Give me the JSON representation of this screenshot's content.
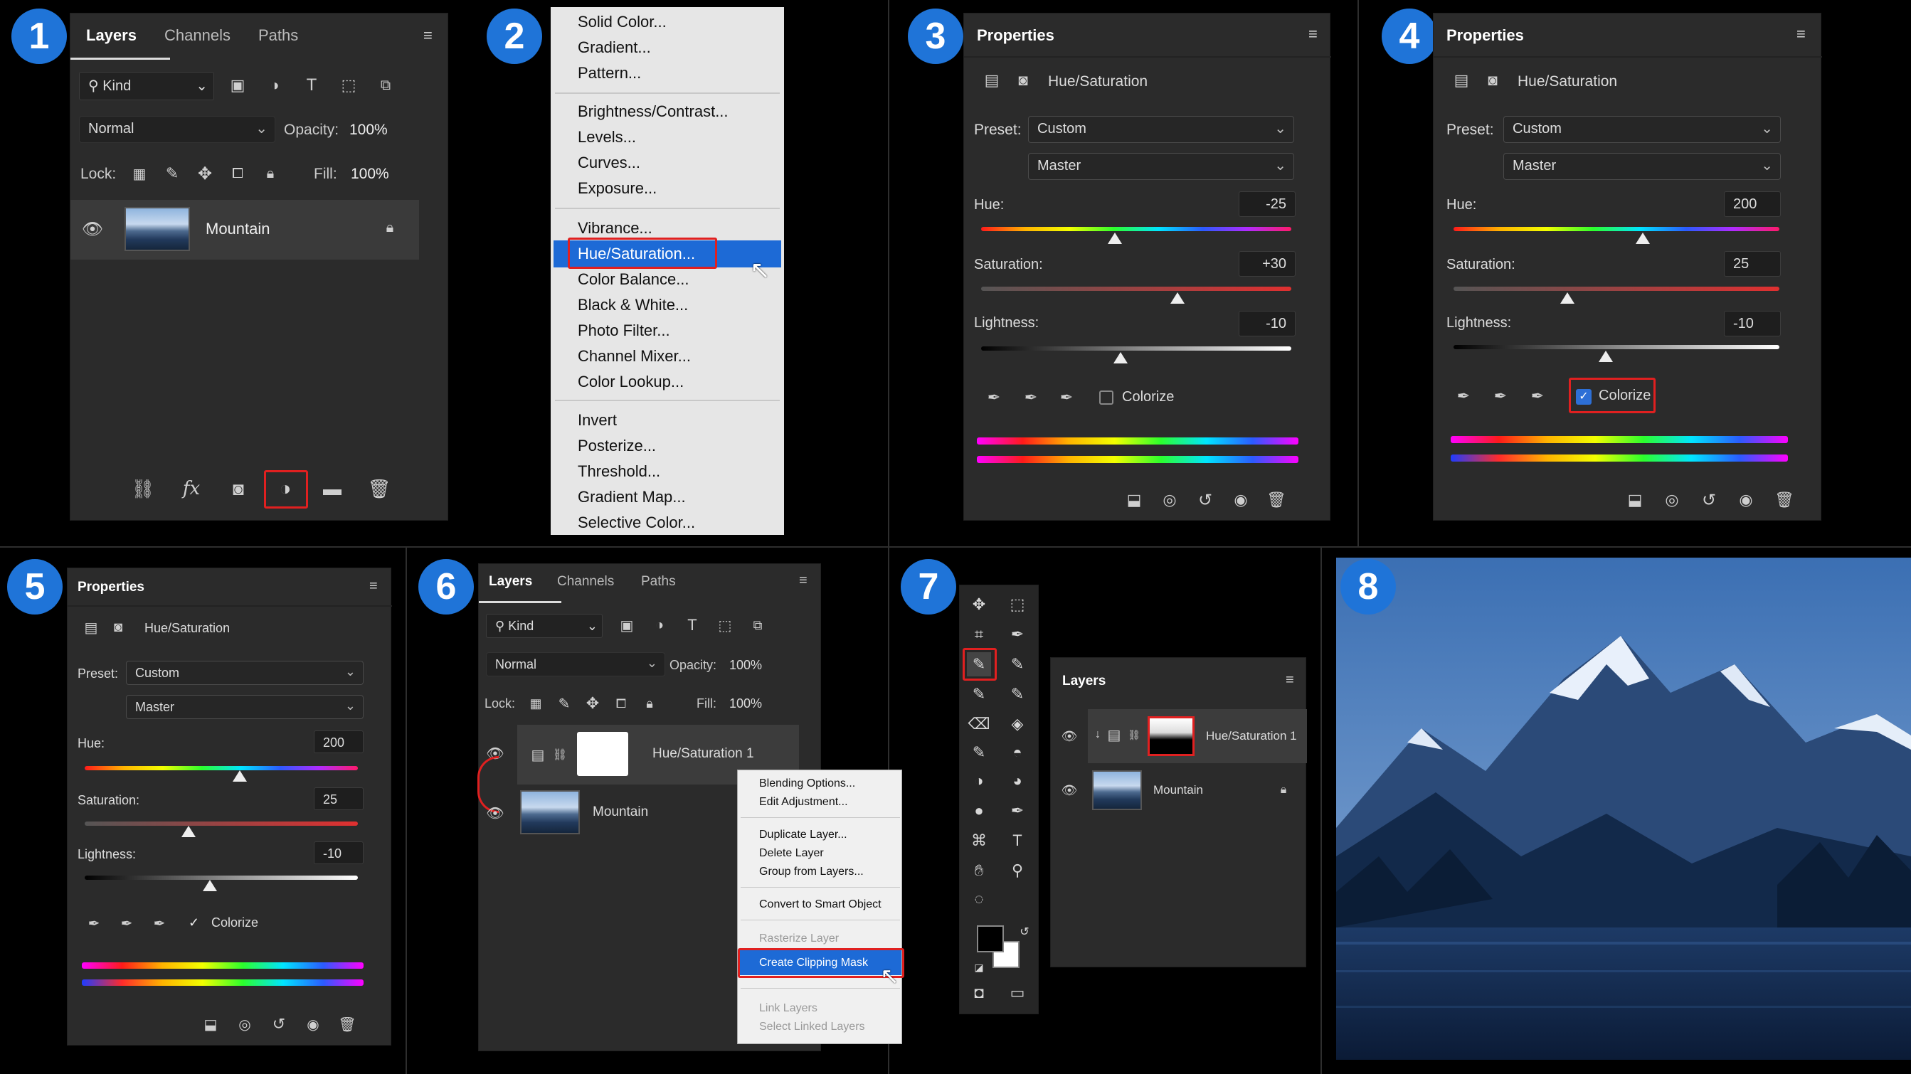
{
  "badges": [
    "1",
    "2",
    "3",
    "4",
    "5",
    "6",
    "7",
    "8"
  ],
  "layers_panel": {
    "tabs": [
      "Layers",
      "Channels",
      "Paths"
    ],
    "filter_label": "Kind",
    "blend_mode": "Normal",
    "opacity_label": "Opacity:",
    "opacity_value": "100%",
    "lock_label": "Lock:",
    "fill_label": "Fill:",
    "fill_value": "100%",
    "layer_name": "Mountain",
    "fx_label": "fx"
  },
  "adjust_menu": {
    "items": [
      "Solid Color...",
      "Gradient...",
      "Pattern...",
      "Brightness/Contrast...",
      "Levels...",
      "Curves...",
      "Exposure...",
      "Vibrance...",
      "Hue/Saturation...",
      "Color Balance...",
      "Black & White...",
      "Photo Filter...",
      "Channel Mixer...",
      "Color Lookup...",
      "Invert",
      "Posterize...",
      "Threshold...",
      "Gradient Map...",
      "Selective Color..."
    ],
    "selected": "Hue/Saturation..."
  },
  "properties_common": {
    "title": "Properties",
    "adjustment_name": "Hue/Saturation",
    "preset_label": "Preset:",
    "preset_value": "Custom",
    "channel_value": "Master",
    "hue_label": "Hue:",
    "saturation_label": "Saturation:",
    "lightness_label": "Lightness:",
    "colorize_label": "Colorize"
  },
  "properties_3": {
    "hue": "-25",
    "saturation": "+30",
    "lightness": "-10",
    "colorize": false,
    "hue_pos": 0.43,
    "sat_pos": 0.63,
    "light_pos": 0.45
  },
  "properties_4": {
    "hue": "200",
    "saturation": "25",
    "lightness": "-10",
    "colorize": true,
    "hue_pos": 0.58,
    "sat_pos": 0.38,
    "light_pos": 0.45
  },
  "properties_5": {
    "hue": "200",
    "saturation": "25",
    "lightness": "-10",
    "colorize": true,
    "hue_pos": 0.58,
    "sat_pos": 0.38,
    "light_pos": 0.45
  },
  "layers_panel_6": {
    "tabs": [
      "Layers",
      "Channels",
      "Paths"
    ],
    "filter_label": "Kind",
    "blend_mode": "Normal",
    "opacity_label": "Opacity:",
    "opacity_value": "100%",
    "lock_label": "Lock:",
    "fill_label": "Fill:",
    "fill_value": "100%",
    "layer_top": "Hue/Saturation 1",
    "layer_bottom": "Mountain"
  },
  "context_menu": {
    "items": [
      "Blending Options...",
      "Edit Adjustment...",
      "Duplicate Layer...",
      "Delete Layer",
      "Group from Layers...",
      "Convert to Smart Object",
      "Rasterize Layer",
      "Create Clipping Mask",
      "Link Layers",
      "Select Linked Layers"
    ],
    "selected": "Create Clipping Mask"
  },
  "layers_panel_7": {
    "title": "Layers",
    "layer_top": "Hue/Saturation 1",
    "layer_bottom": "Mountain"
  },
  "colors": {
    "accent": "#1f74d8",
    "highlight": "#e02020",
    "panel": "#2b2b2b"
  }
}
